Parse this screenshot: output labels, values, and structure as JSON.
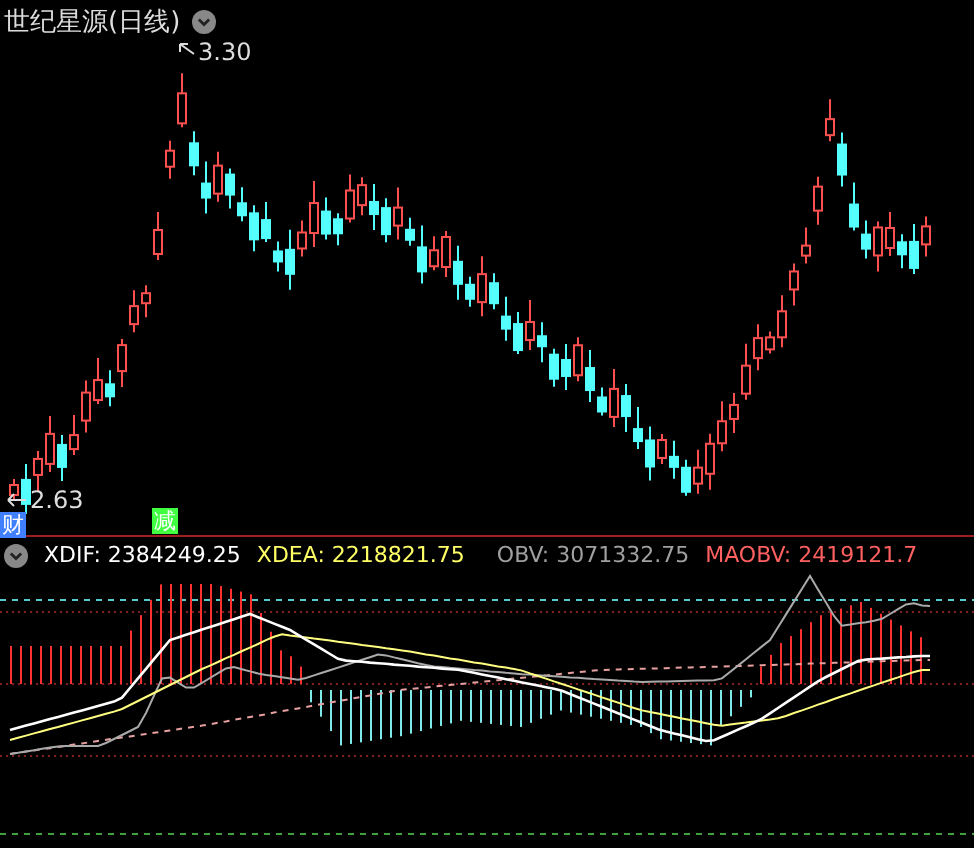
{
  "chart_title": "世纪星源(日线)",
  "price_chart": {
    "high_label": "3.30",
    "low_label": "2.63"
  },
  "event_markers": [
    {
      "text": "财",
      "kind": "finance"
    },
    {
      "text": "减",
      "kind": "reduce"
    }
  ],
  "indicator_legend": [
    {
      "name": "XDIF:",
      "value": "2384249.25",
      "color": "#ffffff"
    },
    {
      "name": "XDEA:",
      "value": "2218821.75",
      "color": "#ffff66"
    },
    {
      "name": "OBV:",
      "value": "3071332.75",
      "color": "#a0a0a0"
    },
    {
      "name": "MAOBV:",
      "value": "2419121.7",
      "color": "#ff6060"
    }
  ]
}
